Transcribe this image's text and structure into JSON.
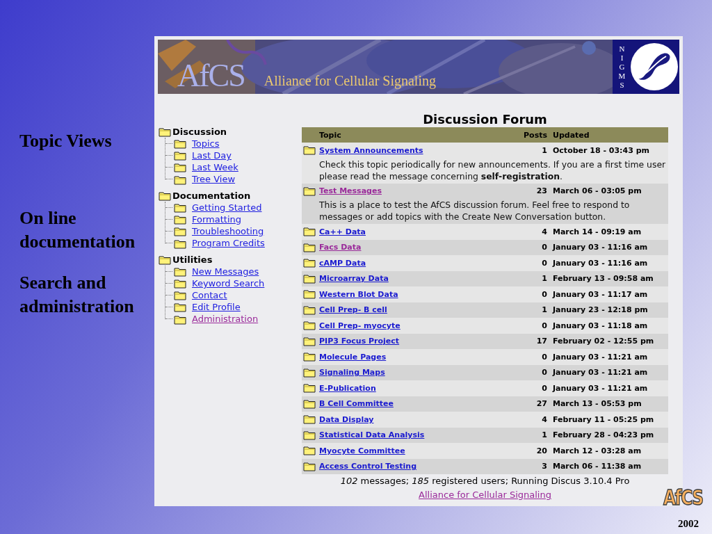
{
  "slide": {
    "labels": [
      "Topic Views",
      "On line documentation",
      "Search and administration"
    ],
    "logo": "AfCS",
    "year": "2002"
  },
  "page": {
    "banner": {
      "logo": "AfCS",
      "title": "Alliance for Cellular Signaling",
      "agency": "NIGMS"
    },
    "sidebar": {
      "groups": [
        {
          "label": "Discussion",
          "children": [
            {
              "label": "Topics",
              "visited": false
            },
            {
              "label": "Last Day",
              "visited": false
            },
            {
              "label": "Last Week",
              "visited": false
            },
            {
              "label": "Tree View",
              "visited": false
            }
          ]
        },
        {
          "label": "Documentation",
          "children": [
            {
              "label": "Getting Started",
              "visited": false
            },
            {
              "label": "Formatting",
              "visited": false
            },
            {
              "label": "Troubleshooting",
              "visited": false
            },
            {
              "label": "Program Credits",
              "visited": false
            }
          ]
        },
        {
          "label": "Utilities",
          "children": [
            {
              "label": "New Messages",
              "visited": false
            },
            {
              "label": "Keyword Search",
              "visited": false
            },
            {
              "label": "Contact",
              "visited": false
            },
            {
              "label": "Edit Profile",
              "visited": false
            },
            {
              "label": "Administration",
              "visited": true
            }
          ]
        }
      ]
    },
    "forum": {
      "title": "Discussion Forum",
      "columns": [
        "Topic",
        "Posts",
        "Updated"
      ],
      "rows": [
        {
          "topic": "System Announcements",
          "visited": false,
          "posts": "1",
          "updated": "October 18 - 03:43 pm",
          "description": "Check this topic periodically for new announcements. If you are a first time user please read the message concerning **self-registration**."
        },
        {
          "topic": "Test Messages",
          "visited": true,
          "posts": "23",
          "updated": "March 06 - 03:05 pm",
          "description": "This is a place to test the AfCS discussion forum. Feel free to respond to messages or add topics with the Create New Conversation button."
        },
        {
          "topic": "Ca++ Data",
          "visited": false,
          "posts": "4",
          "updated": "March 14 - 09:19 am"
        },
        {
          "topic": "Facs Data",
          "visited": true,
          "posts": "0",
          "updated": "January 03 - 11:16 am"
        },
        {
          "topic": "cAMP Data",
          "visited": false,
          "posts": "0",
          "updated": "January 03 - 11:16 am"
        },
        {
          "topic": "Microarray Data",
          "visited": false,
          "posts": "1",
          "updated": "February 13 - 09:58 am"
        },
        {
          "topic": "Western Blot Data",
          "visited": false,
          "posts": "0",
          "updated": "January 03 - 11:17 am"
        },
        {
          "topic": "Cell Prep- B cell",
          "visited": false,
          "posts": "1",
          "updated": "January 23 - 12:18 pm"
        },
        {
          "topic": "Cell Prep- myocyte",
          "visited": false,
          "posts": "0",
          "updated": "January 03 - 11:18 am"
        },
        {
          "topic": "PIP3 Focus Project",
          "visited": false,
          "posts": "17",
          "updated": "February 02 - 12:55 pm"
        },
        {
          "topic": "Molecule Pages",
          "visited": false,
          "posts": "0",
          "updated": "January 03 - 11:21 am"
        },
        {
          "topic": "Signaling Maps",
          "visited": false,
          "posts": "0",
          "updated": "January 03 - 11:21 am"
        },
        {
          "topic": "E-Publication",
          "visited": false,
          "posts": "0",
          "updated": "January 03 - 11:21 am"
        },
        {
          "topic": "B Cell Committee",
          "visited": false,
          "posts": "27",
          "updated": "March 13 - 05:53 pm"
        },
        {
          "topic": "Data Display",
          "visited": false,
          "posts": "4",
          "updated": "February 11 - 05:25 pm"
        },
        {
          "topic": "Statistical Data Analysis",
          "visited": false,
          "posts": "1",
          "updated": "February 28 - 04:23 pm"
        },
        {
          "topic": "Myocyte Committee",
          "visited": false,
          "posts": "20",
          "updated": "March 12 - 03:28 am"
        },
        {
          "topic": "Access Control Testing",
          "visited": false,
          "posts": "3",
          "updated": "March 06 - 11:38 am"
        }
      ]
    },
    "footer": {
      "stats": "*102* messages; *185* registered users; Running Discus 3.10.4 Pro",
      "link": {
        "text": "Alliance for Cellular Signaling",
        "visited": true
      }
    }
  }
}
